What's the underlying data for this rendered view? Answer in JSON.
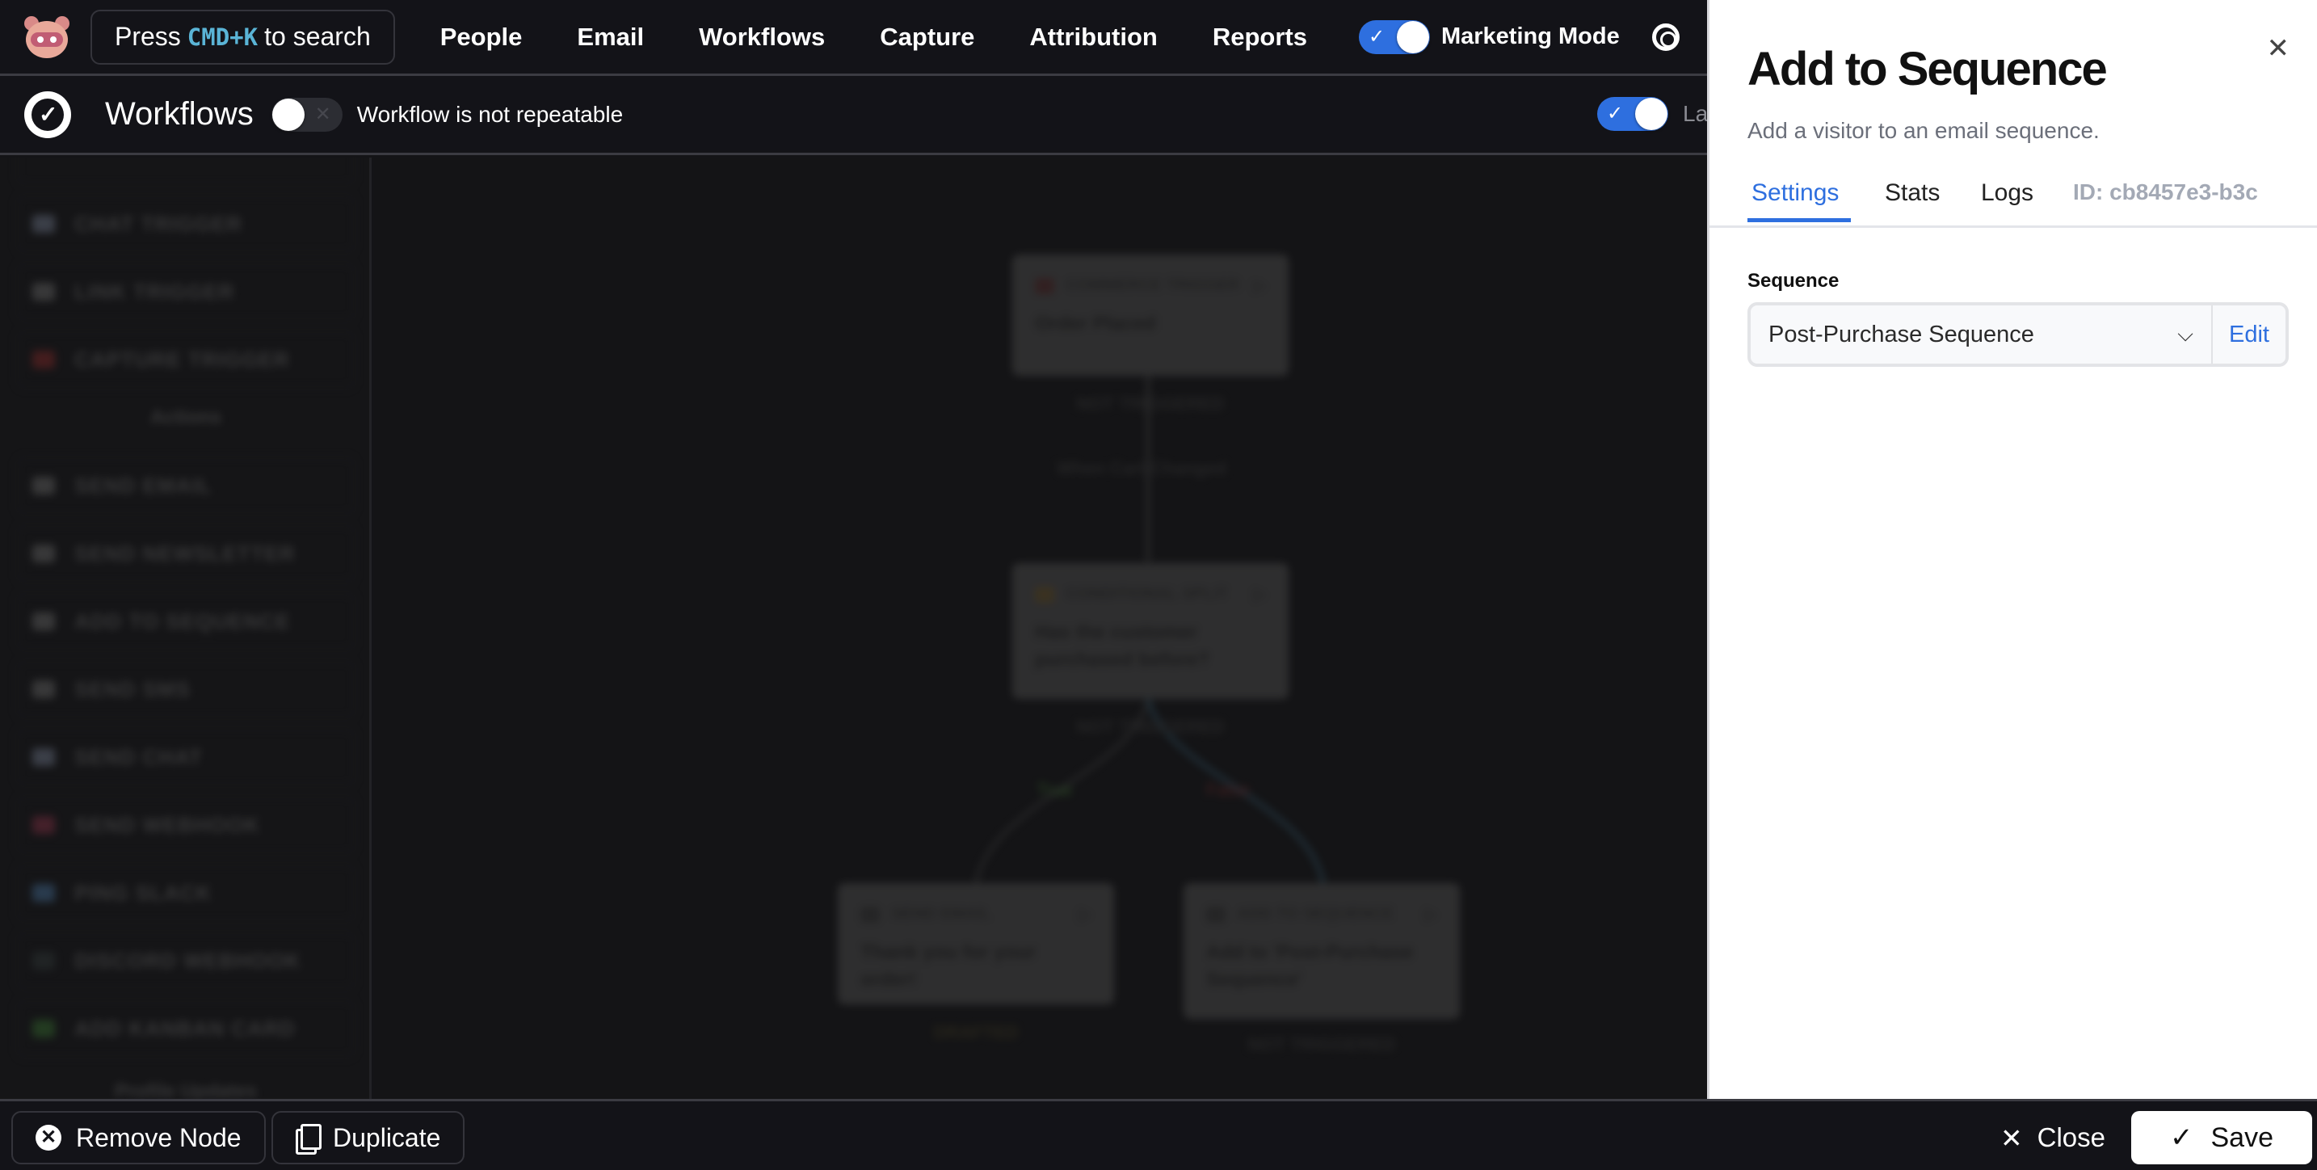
{
  "topnav": {
    "search": {
      "prefix": "Press",
      "shortcut": "CMD+K",
      "suffix": "to search"
    },
    "items": [
      "People",
      "Email",
      "Workflows",
      "Capture",
      "Attribution",
      "Reports"
    ],
    "marketing_mode": {
      "label": "Marketing Mode",
      "enabled": true
    }
  },
  "subheader": {
    "title": "Workflows",
    "repeatable": {
      "enabled": false,
      "label": "Workflow is not repeatable"
    },
    "last_toggle": {
      "enabled": true,
      "label": "Last"
    }
  },
  "sidebar": {
    "triggers": [
      {
        "label": "CHAT TRIGGER",
        "icon": "chat-icon",
        "color": "#5a6170"
      },
      {
        "label": "LINK TRIGGER",
        "icon": "link-icon",
        "color": "#555555"
      },
      {
        "label": "CAPTURE TRIGGER",
        "icon": "heart-icon",
        "color": "#6b2424"
      }
    ],
    "actions_heading": "Actions",
    "actions": [
      {
        "label": "SEND EMAIL",
        "icon": "email-icon",
        "color": "#555555"
      },
      {
        "label": "SEND NEWSLETTER",
        "icon": "newsletter-icon",
        "color": "#555555"
      },
      {
        "label": "ADD TO SEQUENCE",
        "icon": "sequence-icon",
        "color": "#555555"
      },
      {
        "label": "SEND SMS",
        "icon": "sms-icon",
        "color": "#555555"
      },
      {
        "label": "SEND CHAT",
        "icon": "chat-icon",
        "color": "#5a6170"
      },
      {
        "label": "SEND WEBHOOK",
        "icon": "webhook-icon",
        "color": "#6b2a3a"
      },
      {
        "label": "PING SLACK",
        "icon": "slack-icon",
        "color": "#3a5a7a"
      },
      {
        "label": "DISCORD WEBHOOK",
        "icon": "discord-icon",
        "color": "#2a3030"
      },
      {
        "label": "ADD KANBAN CARD",
        "icon": "kanban-icon",
        "color": "#2f5a2a"
      }
    ],
    "profile_heading": "Profile Updates"
  },
  "canvas": {
    "nodes": [
      {
        "type": "COMMERCE TRIGGER",
        "title": "Order Placed",
        "status": "NOT TRIGGERED",
        "icon": "cart-icon",
        "icon_color": "#4a2a2a"
      },
      {
        "type": "CONDITIONAL SPLIT",
        "title": "Has the customer purchased before?",
        "status": "NOT TRIGGERED",
        "icon": "split-icon",
        "icon_color": "#5a4a2a"
      },
      {
        "type": "SEND EMAIL",
        "title": "Thank you for your order!",
        "status": "DRAFTED",
        "icon": "email-icon",
        "icon_color": "#333333"
      },
      {
        "type": "ADD TO SEQUENCE",
        "title": "Add to 'Post-Purchase Sequence'",
        "status": "NOT TRIGGERED",
        "icon": "sequence-icon",
        "icon_color": "#333333"
      }
    ],
    "wait_label": "When Cart Changed",
    "edge_true": "True",
    "edge_false": "False",
    "colors": {
      "true": "#3b6b2f",
      "false": "#6b2a2a",
      "selected_edge": "#2c4a5a"
    }
  },
  "panel": {
    "title": "Add to Sequence",
    "subtitle": "Add a visitor to an email sequence.",
    "tabs": [
      {
        "label": "Settings",
        "active": true
      },
      {
        "label": "Stats",
        "active": false
      },
      {
        "label": "Logs",
        "active": false
      }
    ],
    "id_label": "ID: cb8457e3-b3c",
    "field_label": "Sequence",
    "sequence_value": "Post-Purchase Sequence",
    "edit_label": "Edit",
    "accent": "#2e6fdf"
  },
  "bottombar": {
    "remove_label": "Remove Node",
    "duplicate_label": "Duplicate",
    "close_label": "Close",
    "save_label": "Save"
  }
}
